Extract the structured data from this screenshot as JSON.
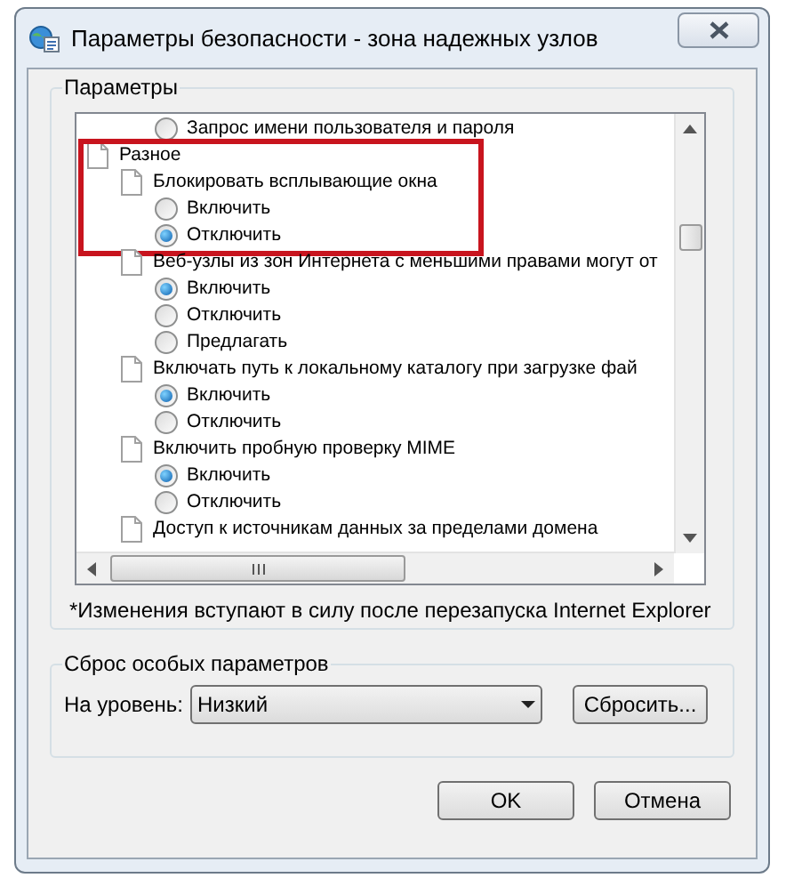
{
  "window": {
    "title": "Параметры безопасности - зона надежных узлов"
  },
  "settings_group": {
    "title": "Параметры",
    "leading_options": [
      {
        "label": "Запрос имени пользователя и пароля",
        "selected": false
      }
    ],
    "categories": [
      {
        "label": "Разное",
        "children": [
          {
            "label": "Блокировать всплывающие окна",
            "highlighted": true,
            "options": [
              {
                "label": "Включить",
                "selected": false
              },
              {
                "label": "Отключить",
                "selected": true
              }
            ]
          },
          {
            "label": "Веб-узлы из зон Интернета с меньшими правами могут от",
            "highlighted": false,
            "options": [
              {
                "label": "Включить",
                "selected": true
              },
              {
                "label": "Отключить",
                "selected": false
              },
              {
                "label": "Предлагать",
                "selected": false
              }
            ]
          },
          {
            "label": "Включать путь к локальному каталогу при загрузке фай",
            "highlighted": false,
            "options": [
              {
                "label": "Включить",
                "selected": true
              },
              {
                "label": "Отключить",
                "selected": false
              }
            ]
          },
          {
            "label": "Включить пробную проверку MIME",
            "highlighted": false,
            "options": [
              {
                "label": "Включить",
                "selected": true
              },
              {
                "label": "Отключить",
                "selected": false
              }
            ]
          },
          {
            "label": "Доступ к источникам данных за пределами домена",
            "highlighted": false
          }
        ]
      }
    ],
    "note": "*Изменения вступают в силу после перезапуска Internet Explorer"
  },
  "reset_group": {
    "title": "Сброс особых параметров",
    "level_label": "На уровень:",
    "level_value": "Низкий",
    "reset_button": "Сбросить..."
  },
  "buttons": [
    {
      "label": "OK"
    },
    {
      "label": "Отмена"
    }
  ]
}
